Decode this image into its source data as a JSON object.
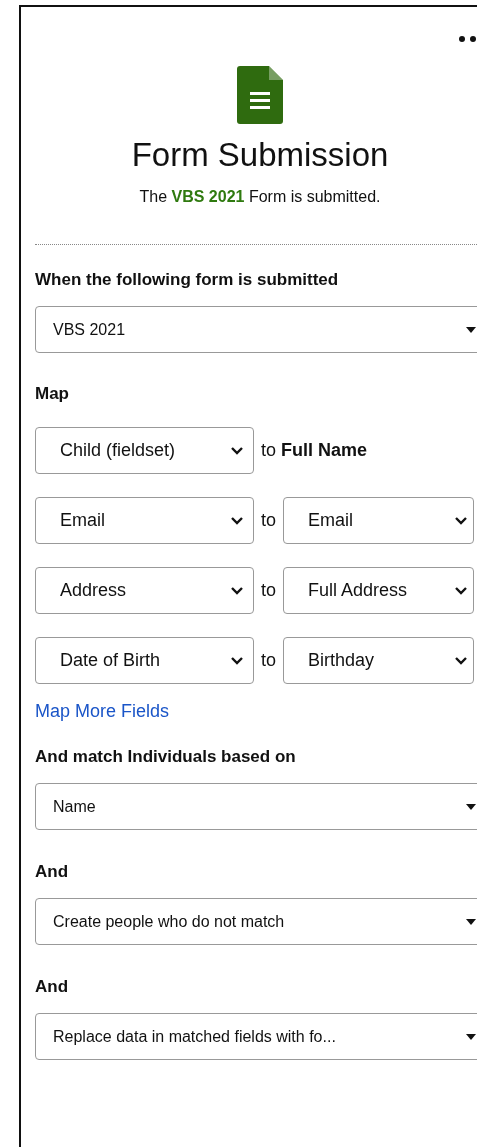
{
  "header": {
    "title": "Form Submission",
    "subtitle": "The **VBS 2021** Form is submitted."
  },
  "trigger": {
    "label": "When the following form is submitted",
    "value": "VBS 2021"
  },
  "map": {
    "label": "Map",
    "rows": [
      {
        "kind": "text",
        "source": "Child (fieldset)",
        "target": "to **Full Name**"
      },
      {
        "kind": "select",
        "source": "Email",
        "connector": "to",
        "target": "Email"
      },
      {
        "kind": "select",
        "source": "Address",
        "connector": "to",
        "target": "Full Address"
      },
      {
        "kind": "select",
        "source": "Date of Birth",
        "connector": "to",
        "target": "Birthday"
      }
    ],
    "link": "Map More Fields"
  },
  "options": [
    {
      "label": "And match Individuals based on",
      "value": "Name"
    },
    {
      "label": "And",
      "value": "Create people who do not match"
    },
    {
      "label": "And",
      "value": "Replace data in matched fields with fo..."
    }
  ]
}
